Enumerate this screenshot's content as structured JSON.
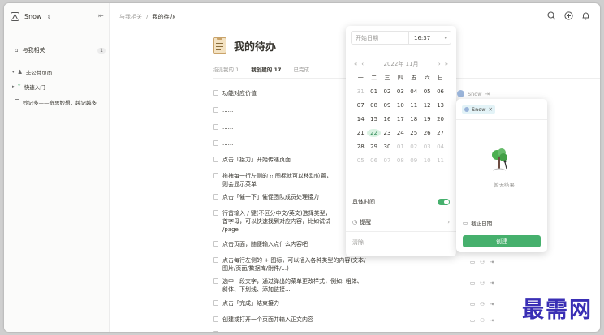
{
  "workspace": {
    "name": "Snow"
  },
  "sidebar": {
    "related_label": "与我相关",
    "related_count": "1",
    "section_title": "非公共页面",
    "items": [
      {
        "label": "快速入门"
      },
      {
        "label": "妙记多——奇思妙想，越记越多"
      }
    ]
  },
  "breadcrumb": {
    "items": [
      "与我相关",
      "我的待办"
    ],
    "separator": "/"
  },
  "page": {
    "title": "我的待办",
    "tabs": [
      {
        "label": "指派我的 1"
      },
      {
        "label": "我创建的 17"
      },
      {
        "label": "已完成"
      }
    ]
  },
  "tasks": [
    {
      "text": "功能对应价值"
    },
    {
      "text": "......"
    },
    {
      "text": "......"
    },
    {
      "text": "......"
    },
    {
      "text": "点击「接力」开始传递页面"
    },
    {
      "text": "拖拽每一行左侧的 ⁝⁝ 图标就可以移动位置，",
      "text2": "则会显示菜单"
    },
    {
      "text": "点击「催一下」催促团队成员处理接力"
    },
    {
      "text": "行首输入 / 键(不区分中文/英文)选择类型，",
      "text2": "首字母，可以快速找到对应内容，比如试试",
      "text3": "/page"
    },
    {
      "text": "点击页面，随便输入点什么内容吧"
    },
    {
      "text": "点击每行左侧的 + 图标，可以插入各种类型的内容(文本/",
      "text2": "图片/页面/数据库/附件/...)"
    },
    {
      "text": "选中一段文字，通过弹出的菜单更改样式，例如: 粗体、",
      "text2": "斜体、下划线、添加链接..."
    },
    {
      "text": "点击「完成」结束接力"
    },
    {
      "text": "创建或打开一个页面并输入正文内容"
    },
    {
      "text": "......"
    }
  ],
  "date_picker": {
    "start_placeholder": "开始日期",
    "time_value": "16:37",
    "month_label": "2022年  11月",
    "weekdays": [
      "一",
      "二",
      "三",
      "四",
      "五",
      "六",
      "日"
    ],
    "days": [
      "31",
      "01",
      "02",
      "03",
      "04",
      "05",
      "06",
      "07",
      "08",
      "09",
      "10",
      "11",
      "12",
      "13",
      "14",
      "15",
      "16",
      "17",
      "18",
      "19",
      "20",
      "21",
      "22",
      "23",
      "24",
      "25",
      "26",
      "27",
      "28",
      "29",
      "30",
      "01",
      "02",
      "03",
      "04",
      "05",
      "06",
      "07",
      "08",
      "09",
      "10",
      "11"
    ],
    "selected_day": "22",
    "specific_time_label": "具体时间",
    "reminder_label": "提醒",
    "clear_label": "清除"
  },
  "assign_panel": {
    "assignee": "Snow",
    "chip": "Snow",
    "empty_text": "暂无结果",
    "deadline_label": "截止日期",
    "create_button": "创建"
  },
  "watermark": "最需网",
  "colors": {
    "accent": "#46b06d",
    "sidebar_bg": "#fbfbfa",
    "watermark": "#3a2fb5"
  }
}
